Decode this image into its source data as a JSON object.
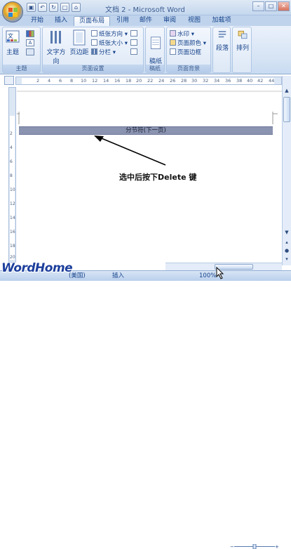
{
  "window": {
    "title": "文档 2 - Microsoft Word"
  },
  "quick_access": [
    "save-icon",
    "undo-icon",
    "redo-icon",
    "new-document-icon",
    "open-folder-icon"
  ],
  "tabs": [
    {
      "label": "开始"
    },
    {
      "label": "插入"
    },
    {
      "label": "页面布局",
      "active": true
    },
    {
      "label": "引用"
    },
    {
      "label": "邮件"
    },
    {
      "label": "审阅"
    },
    {
      "label": "视图"
    },
    {
      "label": "加载项"
    }
  ],
  "ribbon": {
    "theme": {
      "button_label": "主题",
      "group_label": "主题"
    },
    "page_setup": {
      "text_direction": "文字方向",
      "margins": "页边距",
      "orientation": "纸张方向",
      "size": "纸张大小",
      "columns": "分栏",
      "group_label": "页面设置"
    },
    "draft_paper": {
      "button_label": "稿纸\n设置",
      "group_label": "稿纸"
    },
    "page_background": {
      "watermark": "水印",
      "page_color": "页面颜色",
      "page_borders": "页面边框",
      "group_label": "页面背景"
    },
    "paragraph": {
      "button_label": "段落"
    },
    "arrange": {
      "button_label": "排列"
    }
  },
  "ruler": {
    "h_ticks": [
      "2",
      "4",
      "6",
      "8",
      "10",
      "12",
      "14",
      "16",
      "18",
      "20",
      "22",
      "24",
      "26",
      "28",
      "30",
      "32",
      "34",
      "36",
      "38",
      "40",
      "42",
      "44"
    ],
    "v_ticks": [
      "2",
      "4",
      "6",
      "8",
      "10",
      "12",
      "14",
      "16",
      "18",
      "20"
    ]
  },
  "document": {
    "section_break_text": "分节符(下一页)",
    "callout_text": "选中后按下Delete 键"
  },
  "statusbar": {
    "language": "(美国)",
    "insert_mode": "插入",
    "zoom": "100%"
  },
  "watermark_logo": "WordHome",
  "colors": {
    "accent": "#15428b",
    "section_break": "#8a93b0"
  }
}
